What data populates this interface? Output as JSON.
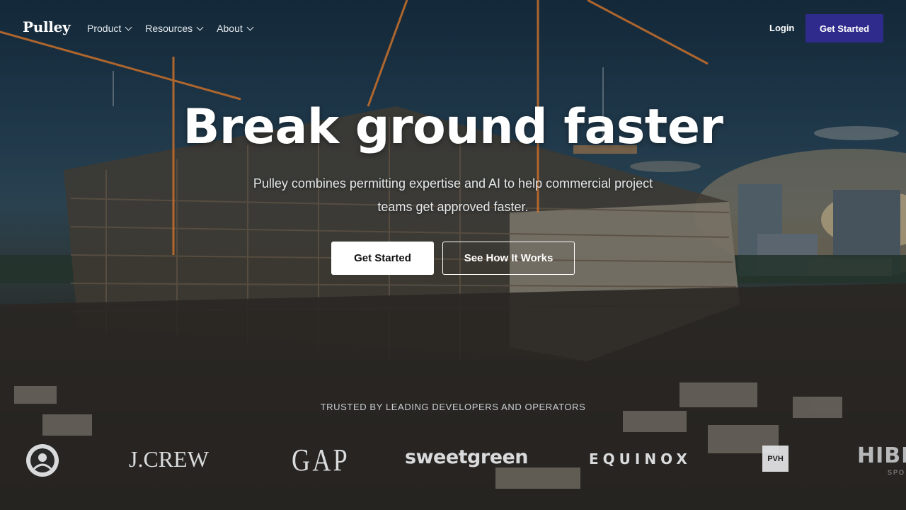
{
  "brand": {
    "logo_text": "Pulley",
    "accent": "#2f2b8c"
  },
  "nav": {
    "items": [
      {
        "label": "Product"
      },
      {
        "label": "Resources"
      },
      {
        "label": "About"
      }
    ],
    "login_label": "Login",
    "cta_label": "Get Started"
  },
  "hero": {
    "headline": "Break ground faster",
    "subtitle": "Pulley combines permitting expertise and AI to help commercial project teams get approved faster.",
    "primary_cta": "Get Started",
    "secondary_cta": "See How It Works"
  },
  "trusted": {
    "label": "TRUSTED BY LEADING DEVELOPERS AND OPERATORS",
    "logos": {
      "jcrew": "J.CREW",
      "gap": "GAP",
      "sweetgreen": "sweetgreen",
      "equinox": "EQUINOX",
      "pvh": "PVH",
      "hibbett": "HIBB",
      "hibbett_sub": "SPO"
    }
  }
}
